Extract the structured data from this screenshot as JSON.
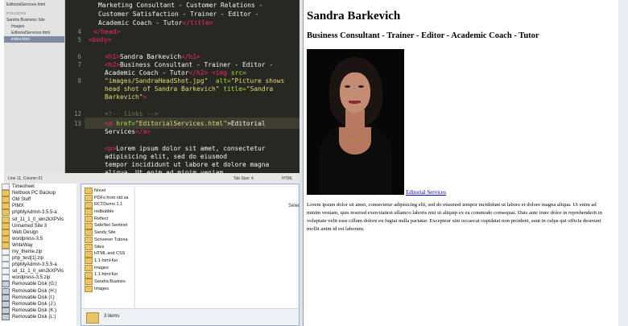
{
  "explorer_back": {
    "items": [
      {
        "label": "Timesheet",
        "icon": "file"
      },
      {
        "label": "Netbook PC Backup",
        "icon": "folder"
      },
      {
        "label": "Old Stuff",
        "icon": "folder"
      },
      {
        "label": "PIMX",
        "icon": "folder"
      },
      {
        "label": "phpMyAdmin-3.5.5-a",
        "icon": "folder"
      },
      {
        "label": "sd_11_1_0_win2kXPVis",
        "icon": "folder"
      },
      {
        "label": "Unnamed Site 3",
        "icon": "folder"
      },
      {
        "label": "Web Design",
        "icon": "folder"
      },
      {
        "label": "wordpress-3.5",
        "icon": "folder"
      },
      {
        "label": "WriteWay",
        "icon": "folder"
      },
      {
        "label": "my_theme.zip",
        "icon": "file"
      },
      {
        "label": "php_test[1].zip",
        "icon": "file"
      },
      {
        "label": "phpMyAdmin-3.5.5-a",
        "icon": "file"
      },
      {
        "label": "sd_11_1_0_win2kXPVis",
        "icon": "file"
      },
      {
        "label": "wordpress-3.5.zip",
        "icon": "file"
      },
      {
        "label": "Removable Disk (G:)",
        "icon": "drive"
      },
      {
        "label": "Removable Disk (H:)",
        "icon": "drive"
      },
      {
        "label": "Removable Disk (I:)",
        "icon": "drive"
      },
      {
        "label": "Removable Disk (J:)",
        "icon": "drive"
      },
      {
        "label": "Removable Disk (K:)",
        "icon": "drive"
      },
      {
        "label": "Removable Disk (L:)",
        "icon": "drive"
      }
    ]
  },
  "explorer_front": {
    "items": [
      {
        "label": "Novel",
        "icon": "folder"
      },
      {
        "label": "PDFs from old sa",
        "icon": "folder"
      },
      {
        "label": "RCTDemo 1.1",
        "icon": "folder"
      },
      {
        "label": "redbubble",
        "icon": "folder"
      },
      {
        "label": "Reflect",
        "icon": "folder"
      },
      {
        "label": "SafeNet Sentinel",
        "icon": "folder"
      },
      {
        "label": "Sandy Site",
        "icon": "folder"
      },
      {
        "label": "Scrivener Tutoria",
        "icon": "folder"
      },
      {
        "label": "Sites",
        "icon": "folder"
      },
      {
        "label": "HTML and CSS",
        "icon": "folder"
      },
      {
        "label": "1.1-html-fun",
        "icon": "folder"
      },
      {
        "label": "images",
        "icon": "folder"
      },
      {
        "label": "1.1-html-fun",
        "icon": "folder"
      },
      {
        "label": "Sandra Busines",
        "icon": "folder"
      },
      {
        "label": "Images",
        "icon": "folder"
      }
    ],
    "status_text": "3 items",
    "select_label": "Selec"
  },
  "editor": {
    "sidebar": {
      "open_file": "EditorialServices.html",
      "folders_header": "FOLDERS",
      "items": [
        {
          "label": "Sandra Business Site"
        },
        {
          "label": "Images"
        },
        {
          "label": "EditorialServices.html"
        },
        {
          "label": "index.html"
        }
      ]
    },
    "line_numbers": [
      "4",
      "5",
      "6",
      "7",
      "8",
      "9",
      "10",
      "11",
      "12",
      "13",
      "14"
    ],
    "code": {
      "l1": "Marketing Consultant - Customer Relations -",
      "l2": "Customer Satisfaction - Trainer - Editor -",
      "l3_text": "Academic Coach - Tutor",
      "l3_tag": "</title>",
      "l4": "</head>",
      "l5": "<body>",
      "l6_open": "<h1>",
      "l6_text": "Sandra Barkevich",
      "l6_close": "</h1>",
      "l7_open": "<h2>",
      "l7_text": "Business Consultant - Trainer - Editor -",
      "l8_text": "Academic Coach - Tutor",
      "l8_close": "</h2>",
      "l8_img": "<img",
      "l8_src": "src=",
      "l9_val": "\"images/SandraHeadShot.jpg\"",
      "l9_alt": "alt=",
      "l9_altval": "\"Picture shows",
      "l10_altval": "head shot of Sandra Barkevich\"",
      "l10_title": "title=",
      "l10_titleval": "\"Sandra",
      "l11_titleval": "Barkevich\"",
      "l11_close": ">",
      "l12": "<!-- links -->",
      "l13_tag": "<a",
      "l13_href": "href=",
      "l13_val": "\"EditorialServices.html\"",
      "l13_text": ">Editorial",
      "l14_text": "Services",
      "l14_close": "</a>",
      "l15_tag": "<p>",
      "l15_text": "Lorem ipsum dolor sit amet, consectetur",
      "l16": "adipisicing elit, sed do eiusmod",
      "l17": "tempor incididunt ut labore et dolore magna",
      "l18": "aliqua. Ut enim ad minim veniam,"
    },
    "status_left": "Line 11, Column 61",
    "status_tab": "Tab Size: 4",
    "status_syntax": "HTML"
  },
  "browser": {
    "heading": "Sandra Barkevich",
    "subheading": "Business Consultant - Trainer - Editor - Academic Coach - Tutor",
    "link_text": "Editorial Services",
    "paragraph": "Lorem ipsum dolor sit amet, consectetur adipisicing elit, sed do eiusmod tempor incididunt ut labore et dolore magna aliqua. Ut enim ad minim veniam, quis nostrud exercitation ullamco laboris nisi ut aliquip ex ea commodo consequat. Duis aute irure dolor in reprehenderit in voluptate velit esse cillum dolore eu fugiat nulla pariatur. Excepteur sint occaecat cupidatat non proident, sunt in culpa qui officia deserunt mollit anim id est laborum."
  }
}
